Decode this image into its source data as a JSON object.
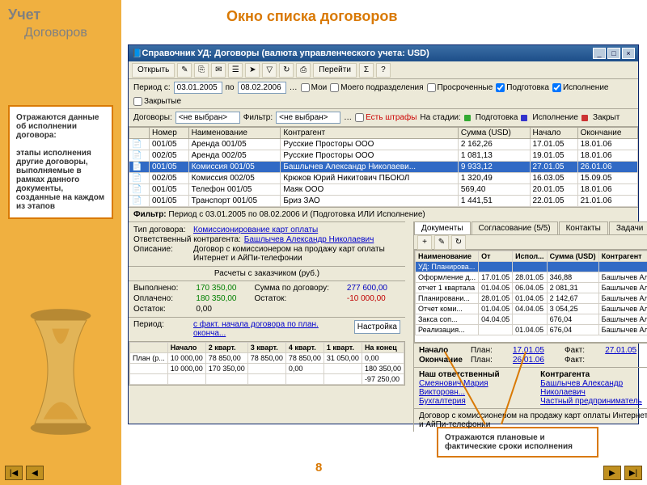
{
  "slide": {
    "title": "Учет",
    "subtitle": "Договоров",
    "heading": "Окно списка договоров",
    "page": "8"
  },
  "callout1": "Отражаются данные об исполнении договора:\n\nэтапы исполнения другие договоры, выполняемые в рамках данного документы, созданные на каждом из этапов",
  "callout2": "Отражаются плановые и фактические сроки исполнения",
  "win": {
    "title": "Справочник УД: Договоры (валюта управленческого учета: USD)",
    "toolbar": {
      "open": "Открыть",
      "goto": "Перейти",
      "sigma": "Σ"
    },
    "period": {
      "lbl": "Период с:",
      "from": "03.01.2005",
      "to": "08.02.2006",
      "mine": "Мои",
      "myunit": "Моего подразделения",
      "overdue": "Просроченные",
      "prep": "Подготовка",
      "exec": "Исполнение",
      "closed": "Закрытые"
    },
    "row2": {
      "contracts": "Договоры:",
      "none": "<не выбран>",
      "filter": "Фильтр:",
      "none2": "<не выбран>",
      "fines": "Есть штрафы",
      "stage": "На стадии:",
      "s_prep": "Подготовка",
      "s_exec": "Исполнение",
      "s_closed": "Закрыт"
    },
    "cols": [
      "",
      "Номер",
      "Наименование",
      "Контрагент",
      "Сумма (USD)",
      "Начало",
      "Окончание"
    ],
    "rows": [
      [
        "001/05",
        "Аренда 001/05",
        "Русские Просторы ООО",
        "2 162,26",
        "17.01.05",
        "18.01.06"
      ],
      [
        "002/05",
        "Аренда 002/05",
        "Русские Просторы ООО",
        "1 081,13",
        "19.01.05",
        "18.01.06"
      ],
      [
        "001/05",
        "Комиссия 001/05",
        "Башлычев Александр Николаеви...",
        "9 933,12",
        "27.01.05",
        "26.01.06"
      ],
      [
        "002/05",
        "Комиссия 002/05",
        "Крюков Юрий Никитович ПБОЮЛ",
        "1 320,49",
        "16.03.05",
        "15.09.05"
      ],
      [
        "001/05",
        "Телефон 001/05",
        "Маяк ООО",
        "569,40",
        "20.01.05",
        "18.01.06"
      ],
      [
        "001/05",
        "Транспорт 001/05",
        "Бриз ЗАО",
        "1 441,51",
        "22.01.05",
        "21.01.06"
      ]
    ],
    "sel": 2,
    "filter": {
      "lbl": "Фильтр:",
      "txt": "Период с 03.01.2005 по 08.02.2006 И (Подготовка ИЛИ Исполнение)"
    },
    "info": {
      "type_l": "Тип договора:",
      "type_v": "Комиссионирование карт оплаты",
      "resp_l": "Ответственный контрагента:",
      "resp_v": "Башлычев Александр Николаевич",
      "desc_l": "Описание:",
      "desc_v": "Договор с комиссионером на продажу карт оплаты Интернет и АйПи-телефонии"
    },
    "calc": {
      "hdr": "Расчеты с заказчиком (руб.)",
      "done_l": "Выполнено:",
      "done_v": "170 350,00",
      "sum_l": "Сумма по договору:",
      "sum_v": "277 600,00",
      "paid_l": "Оплачено:",
      "paid_v": "180 350,00",
      "rem_l": "Остаток:",
      "rem_v": "-10 000,00",
      "rest_l": "Остаток:",
      "rest_v": "0,00",
      "period_l": "Период:",
      "period_v": "с факт. начала договора по план. оконча...",
      "setup": "Настройка"
    },
    "plan": {
      "cols": [
        "",
        "Начало",
        "2 кварт.",
        "3 кварт.",
        "4 кварт.",
        "1 кварт.",
        "На конец"
      ],
      "r1": [
        "План (р...",
        "10 000,00",
        "78 850,00",
        "78 850,00",
        "78 850,00",
        "31 050,00",
        "0,00"
      ],
      "r2": [
        "",
        "10 000,00",
        "170 350,00",
        "",
        "0,00",
        "",
        "180 350,00"
      ],
      "r3": [
        "",
        "",
        "",
        "",
        "",
        "",
        "-97 250,00"
      ]
    },
    "tabs": {
      "t1": "Документы",
      "t2": "Согласование (5/5)",
      "t3": "Контакты",
      "t4": "Задачи"
    },
    "doccols": [
      "Наименование",
      "От",
      "Испол...",
      "Сумма (USD)",
      "Контрагент"
    ],
    "docrows": [
      [
        "УД: Планирова...",
        "",
        "",
        "",
        ""
      ],
      [
        "Оформление д...",
        "17.01.05",
        "28.01.05",
        "346,88",
        "Башлычев Ал..."
      ],
      [
        "отчет 1 квартала",
        "01.04.05",
        "06.04.05",
        "2 081,31",
        "Башлычев Ал..."
      ],
      [
        "Планировани...",
        "28.01.05",
        "01.04.05",
        "2 142,67",
        "Башлычев Ал..."
      ],
      [
        "Отчет коми...",
        "01.04.05",
        "04.04.05",
        "3 054,25",
        "Башлычев Ал..."
      ],
      [
        "Закса соп...",
        "04.04.05",
        "",
        "676,04",
        "Башлычев Ал..."
      ],
      [
        "Реализация...",
        "",
        "01.04.05",
        "676,04",
        "Башлычев Ал..."
      ]
    ],
    "dates": {
      "start_l": "Начало",
      "plan_l": "План:",
      "start_plan": "17.01.05",
      "fact_l": "Факт:",
      "start_fact": "27.01.05",
      "end_l": "Окончание",
      "end_plan": "26.01.06",
      "end_fact": ""
    },
    "resp2": {
      "our_l": "Наш ответственный",
      "our_v": "Смеянович Мария Викторовн...",
      "ctr_l": "Контрагента",
      "ctr_v": "Башлычев Александр Николаевич",
      "bkg": "Бухгалтерия",
      "priv": "Частный предприниматель",
      "bottom": "Договор с комиссионером на продажу карт оплаты Интернет и АйПи-телефонии"
    }
  }
}
